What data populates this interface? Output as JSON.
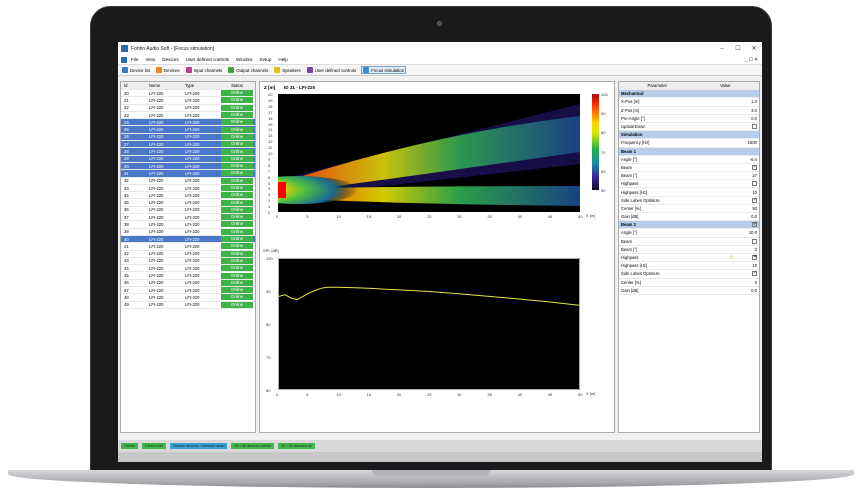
{
  "window": {
    "title": "Fohhn Audio Soft - [Focus simulation]",
    "min": "–",
    "max": "☐",
    "close": "✕"
  },
  "menu": [
    "File",
    "View",
    "Devices",
    "User defined controls",
    "Window",
    "Setup",
    "Help"
  ],
  "menu_right": "_ ☐ ✕",
  "toolbar": [
    {
      "label": "Device list",
      "color": "#3a78c8"
    },
    {
      "label": "Devices",
      "color": "#e88a20"
    },
    {
      "label": "Input channels",
      "color": "#c04090"
    },
    {
      "label": "Output channels",
      "color": "#40a040"
    },
    {
      "label": "Speakers",
      "color": "#e0c020"
    },
    {
      "label": "User defined controls",
      "color": "#8040a0"
    },
    {
      "label": "Focus simulation",
      "color": "#3a90c8",
      "active": true
    }
  ],
  "device_table": {
    "headers": [
      "Id",
      "Name",
      "Type",
      "Status"
    ],
    "rows": [
      {
        "id": "20",
        "name": "LFI-220",
        "type": "LFI-220",
        "status": "Online",
        "sel": false
      },
      {
        "id": "21",
        "name": "LFI-220",
        "type": "LFI-220",
        "status": "Online",
        "sel": false
      },
      {
        "id": "22",
        "name": "LFI-220",
        "type": "LFI-220",
        "status": "Online",
        "sel": false
      },
      {
        "id": "23",
        "name": "LFI-220",
        "type": "LFI-220",
        "status": "Online",
        "sel": false
      },
      {
        "id": "24",
        "name": "LFI-220",
        "type": "LFI-220",
        "status": "Online",
        "sel": true
      },
      {
        "id": "25",
        "name": "LFI-220",
        "type": "LFI-220",
        "status": "Online",
        "sel": true
      },
      {
        "id": "26",
        "name": "LFI-220",
        "type": "LFI-220",
        "status": "Online",
        "sel": true
      },
      {
        "id": "27",
        "name": "LFI-220",
        "type": "LFI-220",
        "status": "Online",
        "sel": true
      },
      {
        "id": "28",
        "name": "LFI-220",
        "type": "LFI-220",
        "status": "Online",
        "sel": true
      },
      {
        "id": "29",
        "name": "LFI-220",
        "type": "LFI-220",
        "status": "Online",
        "sel": true
      },
      {
        "id": "30",
        "name": "LFI-220",
        "type": "LFI-220",
        "status": "Online",
        "sel": true
      },
      {
        "id": "31",
        "name": "LFI-220",
        "type": "LFI-220",
        "status": "Online",
        "sel": true
      },
      {
        "id": "32",
        "name": "LFI-220",
        "type": "LFI-220",
        "status": "Online",
        "sel": false
      },
      {
        "id": "33",
        "name": "LFI-220",
        "type": "LFI-220",
        "status": "Online",
        "sel": false
      },
      {
        "id": "34",
        "name": "LFI-220",
        "type": "LFI-220",
        "status": "Online",
        "sel": false
      },
      {
        "id": "35",
        "name": "LFI-220",
        "type": "LFI-220",
        "status": "Online",
        "sel": false
      },
      {
        "id": "36",
        "name": "LFI-220",
        "type": "LFI-220",
        "status": "Online",
        "sel": false
      },
      {
        "id": "37",
        "name": "LFI-220",
        "type": "LFI-220",
        "status": "Online",
        "sel": false
      },
      {
        "id": "38",
        "name": "LFI-220",
        "type": "LFI-220",
        "status": "Online",
        "sel": false
      },
      {
        "id": "39",
        "name": "LFI-220",
        "type": "LFI-220",
        "status": "Online",
        "sel": false
      },
      {
        "id": "40",
        "name": "LFI-220",
        "type": "LFI-220",
        "status": "Online",
        "sel": true
      },
      {
        "id": "41",
        "name": "LFI-220",
        "type": "LFI-220",
        "status": "Online",
        "sel": false
      },
      {
        "id": "42",
        "name": "LFI-220",
        "type": "LFI-220",
        "status": "Online",
        "sel": false
      },
      {
        "id": "43",
        "name": "LFI-220",
        "type": "LFI-220",
        "status": "Online",
        "sel": false
      },
      {
        "id": "44",
        "name": "LFI-220",
        "type": "LFI-220",
        "status": "Online",
        "sel": false
      },
      {
        "id": "45",
        "name": "LFI-220",
        "type": "LFI-220",
        "status": "Online",
        "sel": false
      },
      {
        "id": "46",
        "name": "LFI-220",
        "type": "LFI-220",
        "status": "Online",
        "sel": false
      },
      {
        "id": "47",
        "name": "LFI-220",
        "type": "LFI-220",
        "status": "Online",
        "sel": false
      },
      {
        "id": "48",
        "name": "LFI-220",
        "type": "LFI-220",
        "status": "Online",
        "sel": false
      },
      {
        "id": "49",
        "name": "LFI-220",
        "type": "LFI-220",
        "status": "Online",
        "sel": false
      }
    ]
  },
  "heatmap": {
    "y_label": "Z [m]",
    "title": "ID 31 - LFI-220",
    "y_ticks": [
      "20",
      "19",
      "18",
      "17",
      "16",
      "15",
      "14",
      "13",
      "12",
      "11",
      "10",
      "9",
      "8",
      "7",
      "6",
      "5",
      "4",
      "3",
      "2",
      "1",
      "0"
    ],
    "x_ticks": [
      "0",
      "5",
      "10",
      "15",
      "20",
      "25",
      "30",
      "35",
      "40",
      "45",
      "50"
    ],
    "x_label": "X [m]",
    "colorbar_ticks": [
      "100",
      "90",
      "80",
      "70",
      "60",
      "50"
    ]
  },
  "spl_plot": {
    "y_label": "SPL [dB]",
    "y_ticks": [
      "100",
      "90",
      "80",
      "70",
      "60"
    ],
    "x_ticks": [
      "0",
      "5",
      "10",
      "15",
      "20",
      "25",
      "30",
      "35",
      "40",
      "45",
      "50"
    ],
    "x_label": "X [m]",
    "line_color": "#e6e64a"
  },
  "params": {
    "headers": [
      "Parameter",
      "Value"
    ],
    "rows": [
      {
        "kind": "section",
        "name": "Mechanical"
      },
      {
        "kind": "val",
        "name": "X-Pos [m]",
        "value": "1.0"
      },
      {
        "kind": "val",
        "name": "Z-Pos [m]",
        "value": "3.0"
      },
      {
        "kind": "val",
        "name": "Pre-Angle [°]",
        "value": "0.0"
      },
      {
        "kind": "chk",
        "name": "UpSideDown",
        "state": "off"
      },
      {
        "kind": "section",
        "name": "Simulation"
      },
      {
        "kind": "val",
        "name": "Frequency [Hz]",
        "value": "1600"
      },
      {
        "kind": "section",
        "name": "Beam 1"
      },
      {
        "kind": "val",
        "name": "Angle [°]",
        "value": "-6.0"
      },
      {
        "kind": "chk",
        "name": "Beam",
        "state": "on"
      },
      {
        "kind": "val",
        "name": "Beam [°]",
        "value": "27"
      },
      {
        "kind": "chk",
        "name": "Highpass",
        "state": "off"
      },
      {
        "kind": "val",
        "name": "Highpass [Hz]",
        "value": "10"
      },
      {
        "kind": "chk",
        "name": "Side Lobes Optimize",
        "state": "on"
      },
      {
        "kind": "val",
        "name": "Center [%]",
        "value": "50"
      },
      {
        "kind": "val",
        "name": "Gain [dB]",
        "value": "0.0"
      },
      {
        "kind": "section",
        "name": "Beam 2",
        "state": "on"
      },
      {
        "kind": "val",
        "name": "Angle [°]",
        "value": "10.0"
      },
      {
        "kind": "chk",
        "name": "Beam",
        "state": "off"
      },
      {
        "kind": "val",
        "name": "Beam [°]",
        "value": "0"
      },
      {
        "kind": "chk",
        "name": "Highpass",
        "state": "x",
        "warn": true
      },
      {
        "kind": "val",
        "name": "Highpass [Hz]",
        "value": "10"
      },
      {
        "kind": "chk",
        "name": "Side Lobes Optimize",
        "state": "on"
      },
      {
        "kind": "val",
        "name": "Center [%]",
        "value": "0"
      },
      {
        "kind": "val",
        "name": "Gain [dB]",
        "value": "0.0"
      }
    ]
  },
  "statusbar": [
    {
      "label": "Online",
      "color": "g"
    },
    {
      "label": "Fohhn-Net",
      "color": "g"
    },
    {
      "label": "Search devices / network scan",
      "color": "b"
    },
    {
      "label": "30 / 30 devices online",
      "color": "g"
    },
    {
      "label": "30 / 30 devices ok",
      "color": "g"
    }
  ],
  "chart_data": [
    {
      "type": "heatmap",
      "title": "ID 31 - LFI-220",
      "xlabel": "X [m]",
      "ylabel": "Z [m]",
      "xlim": [
        0,
        50
      ],
      "ylim": [
        0,
        20
      ],
      "colorbar_range": [
        50,
        100
      ]
    },
    {
      "type": "line",
      "xlabel": "X [m]",
      "ylabel": "SPL [dB]",
      "xlim": [
        0,
        50
      ],
      "ylim": [
        60,
        100
      ],
      "series": [
        {
          "x": [
            0,
            1,
            2,
            3,
            4,
            5,
            6,
            7,
            8,
            10,
            12,
            15,
            20,
            25,
            30,
            35,
            40,
            45,
            50
          ],
          "y": [
            88.5,
            89,
            88,
            87.5,
            88.5,
            89.5,
            90.3,
            91,
            91.3,
            91.3,
            91.2,
            91,
            90.5,
            90,
            89.3,
            88.5,
            87.7,
            86.8,
            85.8
          ]
        }
      ]
    }
  ]
}
